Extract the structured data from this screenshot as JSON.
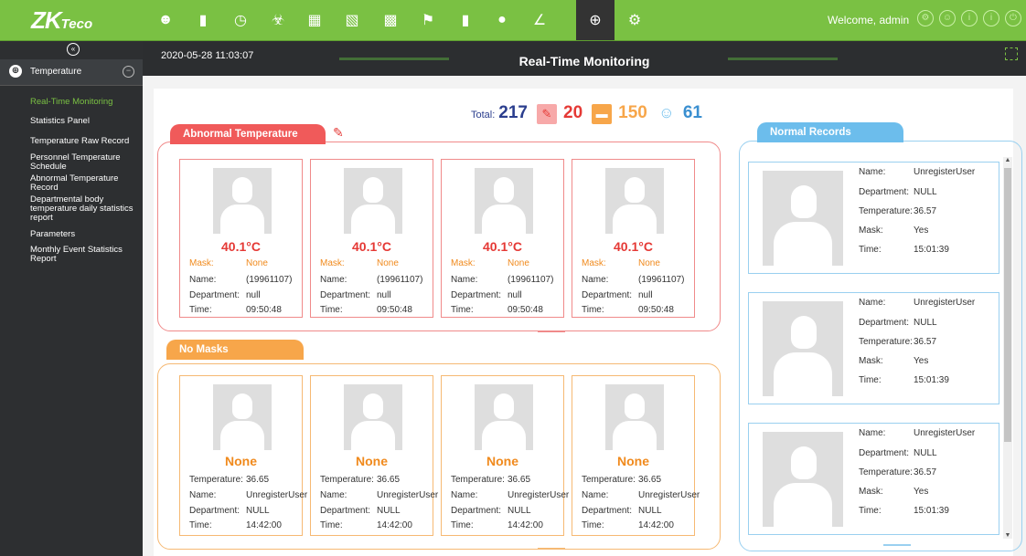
{
  "app": {
    "logo_main": "ZK",
    "logo_sub": "Teco",
    "welcome": "Welcome, admin"
  },
  "colors": {
    "accent": "#7ac143",
    "abnormal": "#f05a5a",
    "nomask": "#f7a64a",
    "normal": "#6cbdec",
    "count_blue": "#2b3e8e"
  },
  "topnav_icons": [
    "personnel-icon",
    "device-icon",
    "time-attendance-icon",
    "access-icon",
    "elevator-icon",
    "hotel-icon",
    "parking-icon",
    "patrol-icon",
    "visitor-icon",
    "consumer-icon",
    "temperature-icon",
    "system-icon"
  ],
  "sidebar": {
    "module_label": "Temperature",
    "items": [
      {
        "label": "Real-Time Monitoring",
        "active": true
      },
      {
        "label": "Statistics Panel"
      },
      {
        "label": "Temperature Raw Record"
      },
      {
        "label": "Personnel Temperature Schedule"
      },
      {
        "label": "Abnormal Temperature Record"
      },
      {
        "label": "Departmental body temperature daily statistics report"
      },
      {
        "label": "Parameters"
      },
      {
        "label": "Monthly Event Statistics Report"
      }
    ]
  },
  "header": {
    "datetime": "2020-05-28 11:03:07",
    "title": "Real-Time Monitoring"
  },
  "totals": {
    "total_label": "Total:",
    "total": "217",
    "abnormal": "20",
    "no_mask": "150",
    "normal": "61"
  },
  "abnormal": {
    "title": "Abnormal Temperature",
    "labels": {
      "mask": "Mask:",
      "name": "Name:",
      "department": "Department:",
      "time": "Time:"
    },
    "cards": [
      {
        "temp": "40.1°C",
        "mask": "None",
        "name": "(19961107)",
        "department": "null",
        "time": "09:50:48"
      },
      {
        "temp": "40.1°C",
        "mask": "None",
        "name": "(19961107)",
        "department": "null",
        "time": "09:50:48"
      },
      {
        "temp": "40.1°C",
        "mask": "None",
        "name": "(19961107)",
        "department": "null",
        "time": "09:50:48"
      },
      {
        "temp": "40.1°C",
        "mask": "None",
        "name": "(19961107)",
        "department": "null",
        "time": "09:50:48"
      }
    ]
  },
  "no_masks": {
    "title": "No Masks",
    "labels": {
      "temperature": "Temperature:",
      "name": "Name:",
      "department": "Department:",
      "time": "Time:"
    },
    "cards": [
      {
        "status": "None",
        "temperature": "36.65",
        "name": "UnregisterUser",
        "department": "NULL",
        "time": "14:42:00"
      },
      {
        "status": "None",
        "temperature": "36.65",
        "name": "UnregisterUser",
        "department": "NULL",
        "time": "14:42:00"
      },
      {
        "status": "None",
        "temperature": "36.65",
        "name": "UnregisterUser",
        "department": "NULL",
        "time": "14:42:00"
      },
      {
        "status": "None",
        "temperature": "36.65",
        "name": "UnregisterUser",
        "department": "NULL",
        "time": "14:42:00"
      }
    ]
  },
  "normal": {
    "title": "Normal Records",
    "labels": {
      "name": "Name:",
      "department": "Department:",
      "temperature": "Temperature:",
      "mask": "Mask:",
      "time": "Time:"
    },
    "records": [
      {
        "name": "UnregisterUser",
        "department": "NULL",
        "temperature": "36.57",
        "mask": "Yes",
        "time": "15:01:39"
      },
      {
        "name": "UnregisterUser",
        "department": "NULL",
        "temperature": "36.57",
        "mask": "Yes",
        "time": "15:01:39"
      },
      {
        "name": "UnregisterUser",
        "department": "NULL",
        "temperature": "36.57",
        "mask": "Yes",
        "time": "15:01:39"
      }
    ]
  }
}
